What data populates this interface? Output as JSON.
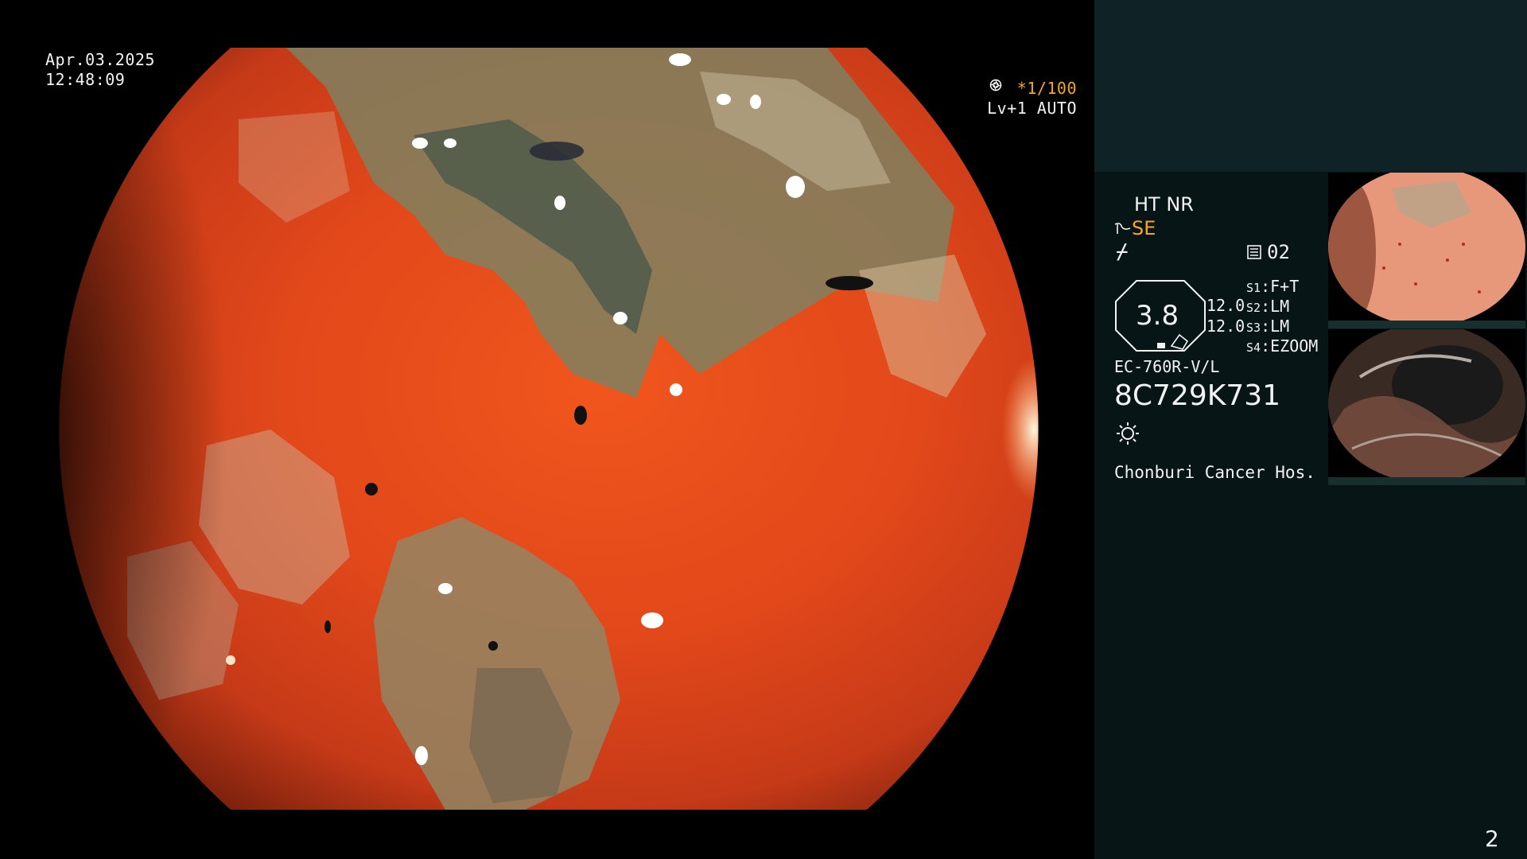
{
  "overlay": {
    "date": "Apr.03.2025",
    "time": "12:48:09",
    "shutter": "*1/100",
    "shutter_icon": "aperture-icon",
    "exposure": "Lv+1 AUTO",
    "exposure_icon": "target-icon"
  },
  "panel": {
    "ht_nr": "HT NR",
    "se_label": "SE",
    "se_icon": "enhance-curve-icon",
    "slash_mark": "⌿",
    "channel_icon": "memory-icon",
    "channel": "02",
    "zoom": "3.8",
    "v1": "12.0",
    "v2": "12.0",
    "switches": [
      {
        "key": "S1",
        "value": "F+T"
      },
      {
        "key": "S2",
        "value": "LM"
      },
      {
        "key": "S3",
        "value": "LM"
      },
      {
        "key": "S4",
        "value": "EZOOM"
      }
    ],
    "scope_model": "EC-760R-V/L",
    "serial": "8C729K731",
    "light_icon": "sun-icon",
    "hospital": "Chonburi Cancer Hos.",
    "page_number": "2"
  },
  "colors": {
    "accent_orange": "#f5a623",
    "panel_bg": "#071516",
    "panel_top_bg": "#0f2326",
    "tissue_red": "#e8461a"
  }
}
